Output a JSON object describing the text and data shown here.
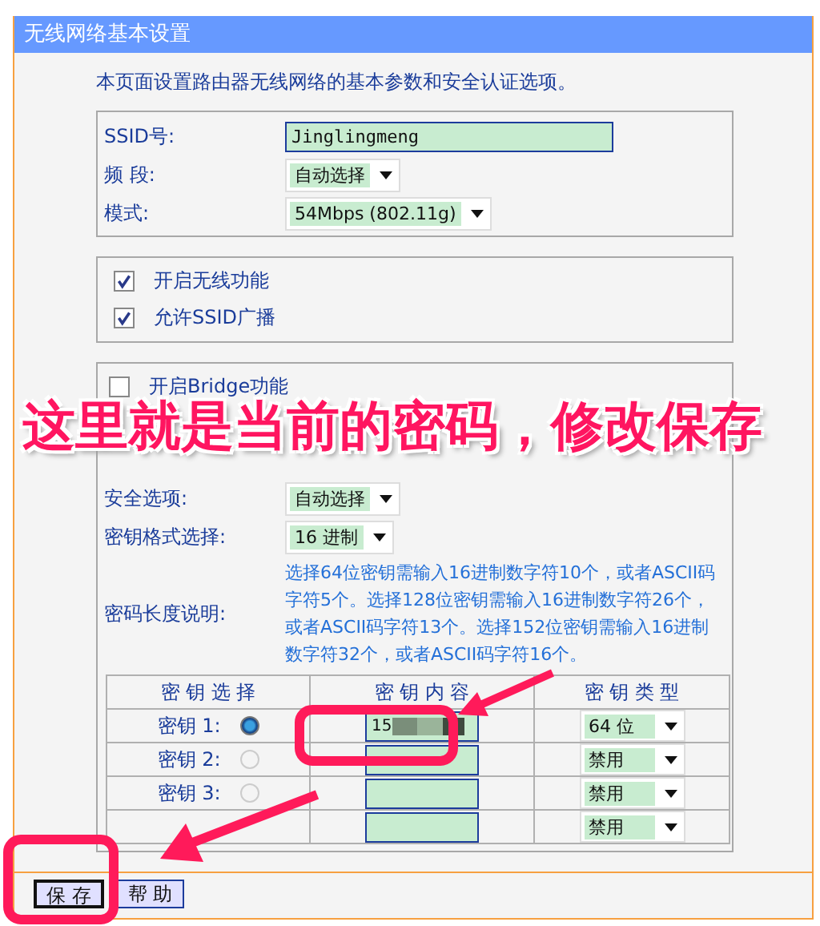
{
  "panel": {
    "title": "无线网络基本设置",
    "intro": "本页面设置路由器无线网络的基本参数和安全认证选项。",
    "basic": [
      {
        "label": "SSID号:",
        "kind": "text",
        "value": "Jinglingmeng"
      },
      {
        "label": "频 段:",
        "kind": "select",
        "value": "自动选择"
      },
      {
        "label": "模式:",
        "kind": "select",
        "value": "54Mbps (802.11g)"
      }
    ],
    "toggles": [
      {
        "label": "开启无线功能",
        "checked": true
      },
      {
        "label": "允许SSID广播",
        "checked": true
      }
    ],
    "bridge": {
      "label": "开启Bridge功能",
      "checked": false
    },
    "security": [
      {
        "label": "安全选项:",
        "kind": "select",
        "value": "自动选择"
      },
      {
        "label": "密钥格式选择:",
        "kind": "select",
        "value": "16 进制"
      },
      {
        "label": "密码长度说明:",
        "kind": "note",
        "value": "选择64位密钥需输入16进制数字符10个，或者ASCII码字符5个。选择128位密钥需输入16进制数字符26个，或者ASCII码字符13个。选择152位密钥需输入16进制数字符32个，或者ASCII码字符16个。"
      }
    ],
    "key_table": {
      "columns": [
        "密 钥 选 择",
        "密 钥 内 容",
        "密 钥 类 型"
      ],
      "rows": [
        {
          "label": "密钥 1:",
          "selected": true,
          "value": "15",
          "masked": true,
          "type": "64 位"
        },
        {
          "label": "密钥 2:",
          "selected": false,
          "type": "禁用"
        },
        {
          "label": "密钥 3:",
          "selected": false,
          "type": "禁用"
        },
        {
          "type": "禁用"
        }
      ]
    },
    "buttons": [
      {
        "label": "保 存",
        "selected": true
      },
      {
        "label": "帮 助",
        "selected": false
      }
    ]
  },
  "annotation": {
    "text": "这里就是当前的密码，修改保存"
  }
}
